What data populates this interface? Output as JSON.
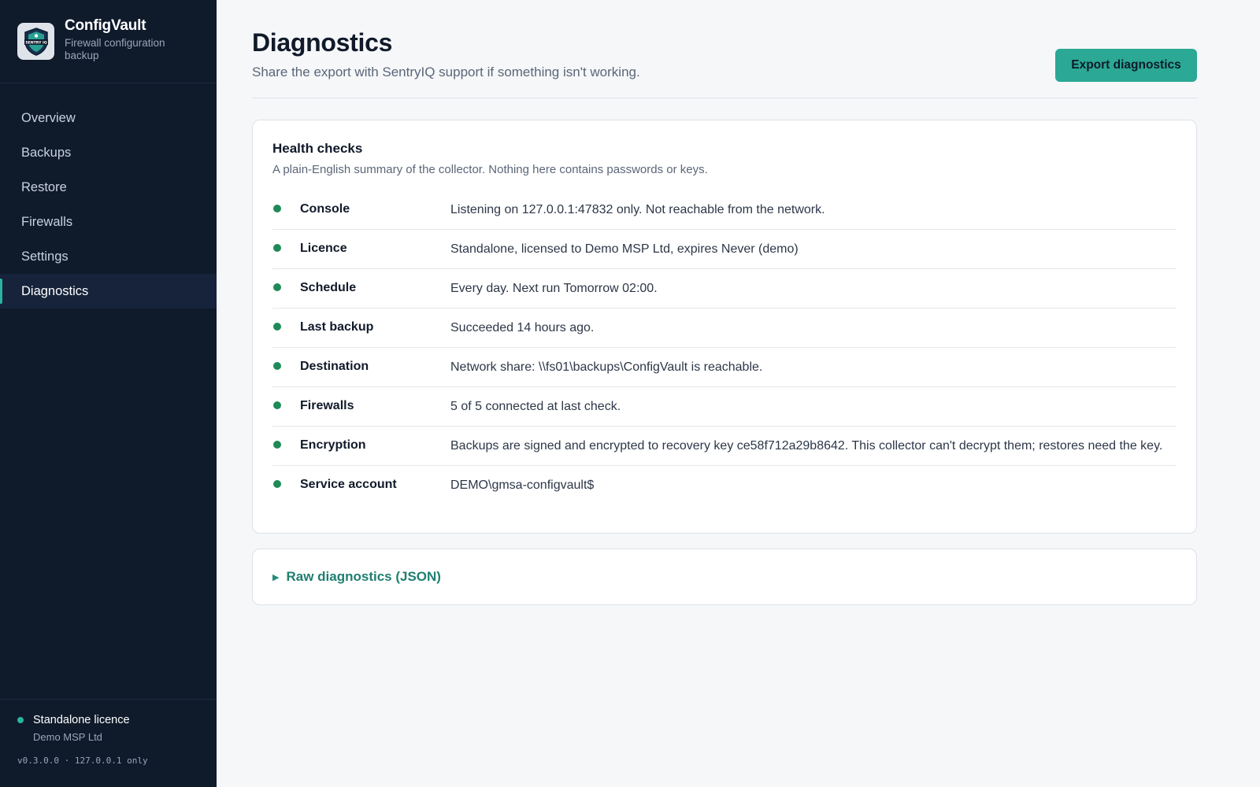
{
  "app": {
    "name": "ConfigVault",
    "subtitle": "Firewall configuration backup",
    "logo_icon": "shield-logo-icon",
    "logo_text": "SENTRY IQ"
  },
  "sidebar": {
    "items": [
      {
        "label": "Overview",
        "active": false
      },
      {
        "label": "Backups",
        "active": false
      },
      {
        "label": "Restore",
        "active": false
      },
      {
        "label": "Firewalls",
        "active": false
      },
      {
        "label": "Settings",
        "active": false
      },
      {
        "label": "Diagnostics",
        "active": true
      }
    ],
    "licence": {
      "title": "Standalone licence",
      "org": "Demo MSP Ltd",
      "status_color": "#2bb3a0"
    },
    "version": "v0.3.0.0 · 127.0.0.1 only"
  },
  "header": {
    "title": "Diagnostics",
    "subtitle": "Share the export with SentryIQ support if something isn't working.",
    "export_label": "Export diagnostics"
  },
  "health": {
    "title": "Health checks",
    "subtitle": "A plain-English summary of the collector. Nothing here contains passwords or keys.",
    "status_color": "#1e8a58",
    "checks": [
      {
        "label": "Console",
        "value": "Listening on 127.0.0.1:47832 only. Not reachable from the network."
      },
      {
        "label": "Licence",
        "value": "Standalone, licensed to Demo MSP Ltd, expires Never (demo)"
      },
      {
        "label": "Schedule",
        "value": "Every day. Next run Tomorrow 02:00."
      },
      {
        "label": "Last backup",
        "value": "Succeeded 14 hours ago."
      },
      {
        "label": "Destination",
        "value": "Network share: \\\\fs01\\backups\\ConfigVault is reachable."
      },
      {
        "label": "Firewalls",
        "value": "5 of 5 connected at last check."
      },
      {
        "label": "Encryption",
        "value": "Backups are signed and encrypted to recovery key ce58f712a29b8642. This collector can't decrypt them; restores need the key."
      },
      {
        "label": "Service account",
        "value": "DEMO\\gmsa-configvault$"
      }
    ]
  },
  "raw": {
    "label": "Raw diagnostics (JSON)",
    "caret_icon": "caret-right-icon"
  }
}
